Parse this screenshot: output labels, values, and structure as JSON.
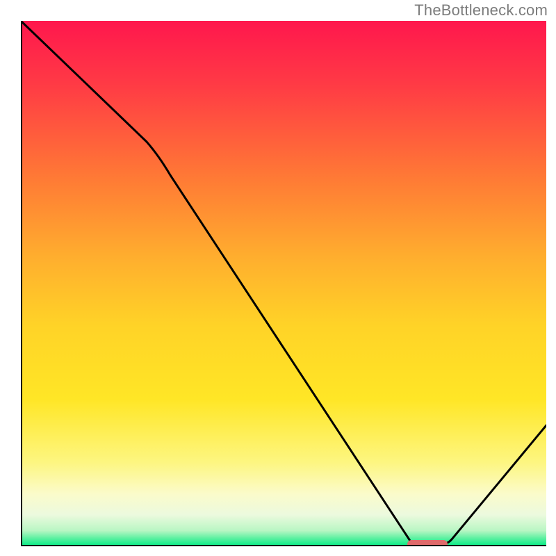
{
  "attribution": "TheBottleneck.com",
  "chart_data": {
    "type": "line",
    "title": "",
    "xlabel": "",
    "ylabel": "",
    "xlim": [
      0,
      100
    ],
    "ylim": [
      0,
      100
    ],
    "x": [
      0,
      24,
      74,
      80,
      100
    ],
    "values": [
      100,
      77,
      0,
      0,
      23
    ],
    "marker": {
      "x_start": 74,
      "x_end": 80,
      "y": 0
    },
    "annotations": [],
    "background_gradient": [
      "#ff174d",
      "#ffb32f",
      "#ffde26",
      "#fbf8b7",
      "#f5fce2",
      "#01eb83"
    ]
  }
}
